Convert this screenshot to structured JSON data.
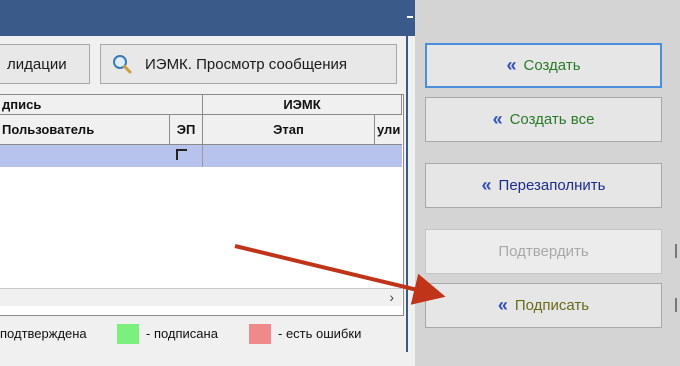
{
  "left_panel": {
    "validation_button_partial": "лидации",
    "view_message_button": "ИЭМК. Просмотр сообщения",
    "table": {
      "group_header_signature": "дпись",
      "group_header_iemk": "ИЭМК",
      "col_user": "Пользователь",
      "col_ep": "ЭП",
      "col_stage": "Этап",
      "col_partial": "ули"
    },
    "scroll_right_glyph": "›",
    "legend": {
      "confirmed": "подтверждена",
      "signed": "- подписана",
      "errors": "- есть ошибки",
      "signed_color": "#7cf07c",
      "errors_color": "#f08a8a"
    }
  },
  "right_panel": {
    "create": "Создать",
    "create_all": "Создать все",
    "refill": "Перезаполнить",
    "confirm": "Подтвердить",
    "sign": "Подписать",
    "double_arrow_glyph": "«"
  },
  "colors": {
    "titlebar": "#3a5a8a",
    "selected_row": "#b7c3ec",
    "create_text": "#2a7a2a",
    "create_all_text": "#2a7a2a",
    "refill_text": "#1c2c8a",
    "confirm_text": "#a8a8a8",
    "sign_text": "#6a6a1a",
    "arrow": "#c0351a"
  }
}
